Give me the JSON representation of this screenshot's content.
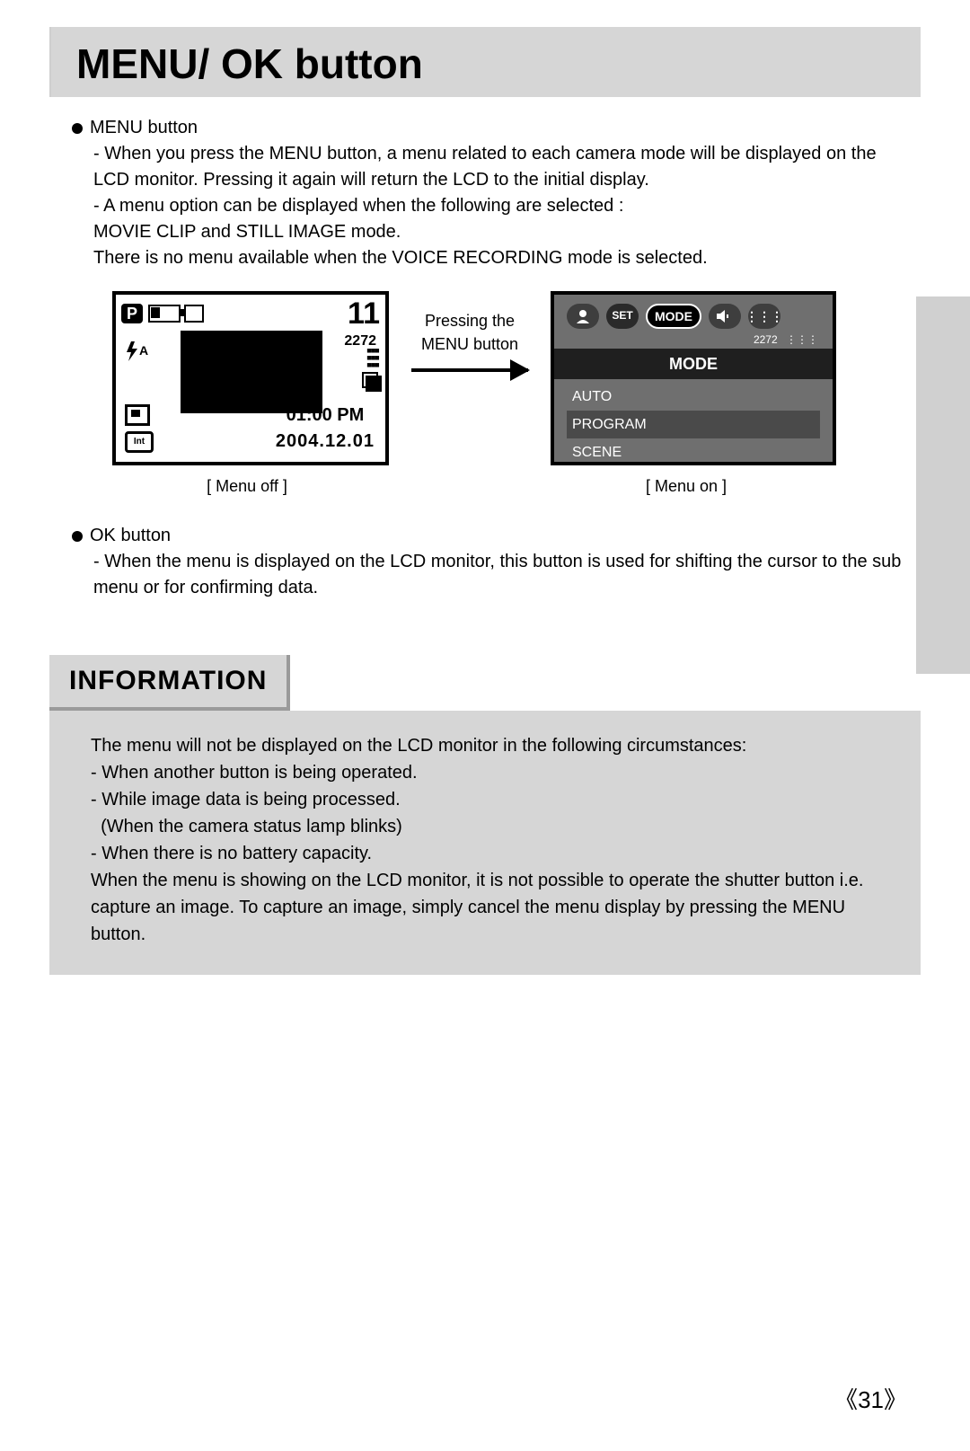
{
  "title": "MENU/ OK button",
  "section1": {
    "heading": "MENU button",
    "lines": [
      "- When you press the MENU button, a menu related to each camera mode will be displayed on the LCD monitor. Pressing it again will return the LCD to the initial display.",
      "- A menu option can be displayed when the following are selected :",
      "MOVIE CLIP and STILL IMAGE mode.",
      "There is no menu available when the VOICE RECORDING mode is selected."
    ]
  },
  "figure": {
    "between_top": "Pressing the",
    "between_bottom": "MENU button",
    "lcd_off": {
      "mode_badge": "P",
      "count": "11",
      "resolution": "2272",
      "flash": "ƒA",
      "int_label": "Int",
      "time": "01:00 PM",
      "date": "2004.12.01"
    },
    "lcd_on": {
      "set_label": "SET",
      "mode_tab": "MODE",
      "resolution": "2272",
      "header": "MODE",
      "items": [
        "AUTO",
        "PROGRAM",
        "SCENE"
      ],
      "selected_index": 1
    },
    "caption_off": "[ Menu off ]",
    "caption_on": "[ Menu on ]"
  },
  "section2": {
    "heading": "OK button",
    "line": "- When the menu is displayed on the LCD monitor, this button is used for shifting the cursor to the sub menu or for confirming data."
  },
  "info": {
    "title": "INFORMATION",
    "lines": [
      "The menu will not be displayed on the LCD monitor in the following circumstances:",
      "- When another button is being operated.",
      "- While image data is being processed.",
      "  (When the camera status lamp blinks)",
      "- When there is no battery capacity.",
      "When the menu is showing on the LCD monitor, it is not possible to operate the shutter button i.e. capture an image. To capture an image, simply cancel the menu display by pressing the MENU button."
    ]
  },
  "page_number": "31"
}
